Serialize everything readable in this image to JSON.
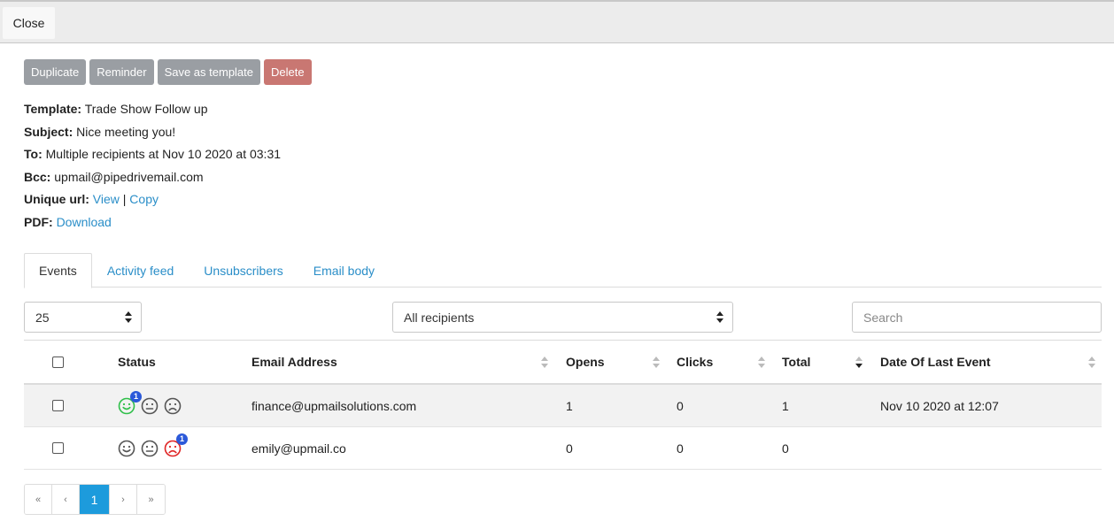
{
  "topbar": {
    "close_label": "Close"
  },
  "actions": {
    "duplicate": "Duplicate",
    "reminder": "Reminder",
    "save_template": "Save as template",
    "delete": "Delete"
  },
  "info": {
    "template_label": "Template:",
    "template_value": "Trade Show Follow up",
    "subject_label": "Subject:",
    "subject_value": "Nice meeting you!",
    "to_label": "To:",
    "to_value": "Multiple recipients at Nov 10 2020 at 03:31",
    "bcc_label": "Bcc:",
    "bcc_value": "upmail@pipedrivemail.com",
    "url_label": "Unique url:",
    "url_view": "View",
    "url_sep": "|",
    "url_copy": "Copy",
    "pdf_label": "PDF:",
    "pdf_download": "Download"
  },
  "tabs": [
    {
      "label": "Events",
      "active": true
    },
    {
      "label": "Activity feed",
      "active": false
    },
    {
      "label": "Unsubscribers",
      "active": false
    },
    {
      "label": "Email body",
      "active": false
    }
  ],
  "filters": {
    "page_size": "25",
    "recipients": "All recipients",
    "search_placeholder": "Search"
  },
  "table": {
    "columns": {
      "status": "Status",
      "email": "Email Address",
      "opens": "Opens",
      "clicks": "Clicks",
      "total": "Total",
      "last_event": "Date Of Last Event"
    },
    "sorted_column": "Total",
    "rows": [
      {
        "email": "finance@upmailsolutions.com",
        "opens": "1",
        "clicks": "0",
        "total": "1",
        "last_event": "Nov 10 2020 at 12:07",
        "status": [
          {
            "face": "happy",
            "active": true,
            "color": "#2fbf4a",
            "badge": "1"
          },
          {
            "face": "neutral",
            "active": false,
            "color": "#555555",
            "badge": ""
          },
          {
            "face": "sad",
            "active": false,
            "color": "#555555",
            "badge": ""
          }
        ]
      },
      {
        "email": "emily@upmail.co",
        "opens": "0",
        "clicks": "0",
        "total": "0",
        "last_event": "",
        "status": [
          {
            "face": "happy",
            "active": false,
            "color": "#555555",
            "badge": ""
          },
          {
            "face": "neutral",
            "active": false,
            "color": "#555555",
            "badge": ""
          },
          {
            "face": "sad",
            "active": true,
            "color": "#e02424",
            "badge": "1"
          }
        ]
      }
    ]
  },
  "pagination": {
    "first": "«",
    "prev": "‹",
    "current": "1",
    "next": "›",
    "last": "»"
  },
  "colors": {
    "link": "#2a8ec8",
    "action_gray": "#9a9ea3",
    "delete": "#c97772",
    "pager_active": "#1d9bdc",
    "badge": "#2b59d9"
  }
}
